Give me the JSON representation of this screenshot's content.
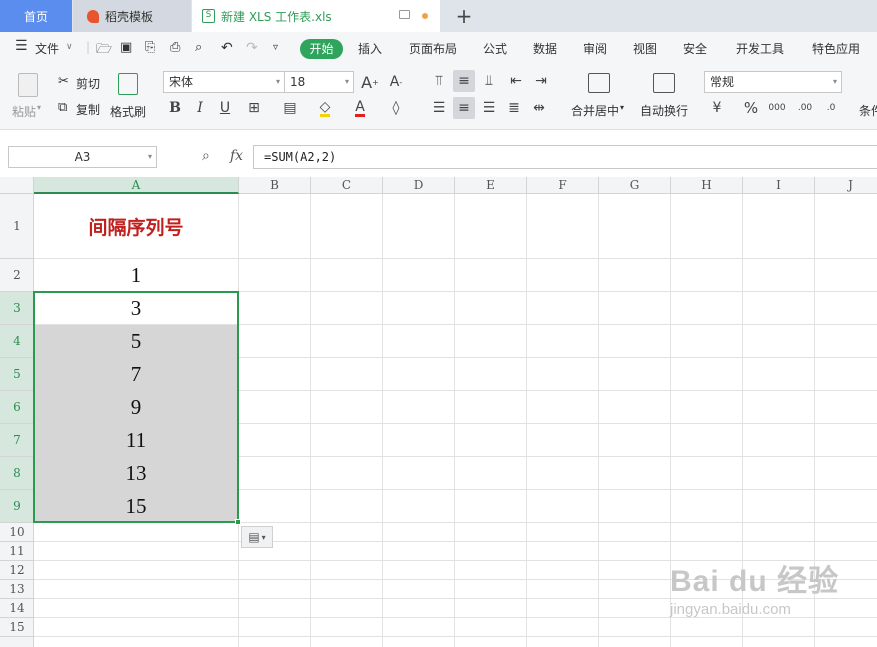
{
  "tabs": {
    "home": "首页",
    "templates": "稻壳模板",
    "file": "新建 XLS 工作表.xls"
  },
  "menu": {
    "file": "文件",
    "items": [
      "开始",
      "插入",
      "页面布局",
      "公式",
      "数据",
      "审阅",
      "视图",
      "安全",
      "开发工具",
      "特色应用"
    ]
  },
  "ribbon": {
    "paste": "粘贴",
    "cut": "剪切",
    "copy": "复制",
    "format_painter": "格式刷",
    "font_name": "宋体",
    "font_size": "18",
    "merge_center": "合并居中",
    "wrap_text": "自动换行",
    "number_format": "常规",
    "conditional": "条件"
  },
  "formula_bar": {
    "name_box": "A3",
    "fx": "fx",
    "formula": "=SUM(A2,2)"
  },
  "columns": [
    "A",
    "B",
    "C",
    "D",
    "E",
    "F",
    "G",
    "H",
    "I",
    "J"
  ],
  "rows": [
    "1",
    "2",
    "3",
    "4",
    "5",
    "6",
    "7",
    "8",
    "9",
    "10",
    "11",
    "12",
    "13",
    "14",
    "15"
  ],
  "sheet": {
    "A1": "间隔序列号",
    "A2": "1",
    "A3": "3",
    "A4": "5",
    "A5": "7",
    "A6": "9",
    "A7": "11",
    "A8": "13",
    "A9": "15"
  },
  "watermark": {
    "logo": "Bai du 经验",
    "url": "jingyan.baidu.com"
  },
  "colors": {
    "accent_green": "#2fa45c",
    "title_red": "#c0201e",
    "home_blue": "#5b8def"
  }
}
